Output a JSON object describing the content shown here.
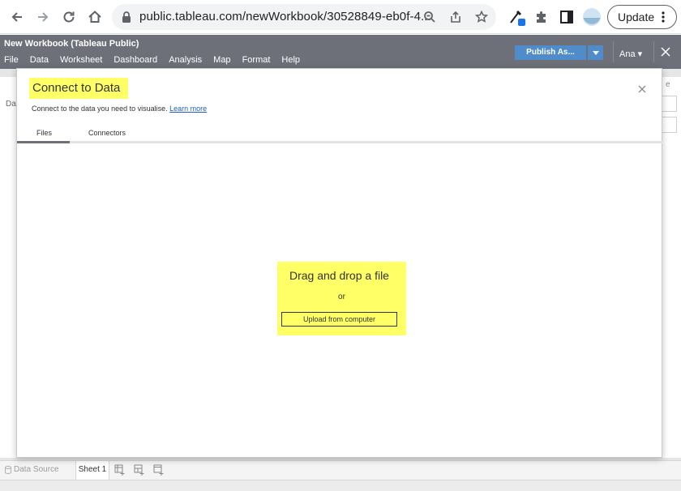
{
  "browser": {
    "url": "public.tableau.com/newWorkbook/30528849-eb0f-4...",
    "update_label": "Update",
    "icons": [
      "back-arrow-icon",
      "forward-arrow-icon",
      "reload-icon",
      "home-icon",
      "lock-icon",
      "zoom-icon",
      "share-icon",
      "star-icon",
      "eyedropper-extension-icon",
      "puzzle-icon",
      "sidepanel-icon",
      "profile-avatar-icon",
      "kebab-menu-icon"
    ]
  },
  "app": {
    "title": "New Workbook (Tableau Public)",
    "menu": [
      "File",
      "Data",
      "Worksheet",
      "Dashboard",
      "Analysis",
      "Map",
      "Format",
      "Help"
    ],
    "publish_label": "Publish As...",
    "user_label": "Ana ▾",
    "accent_color": "#4f8cc9",
    "header_color": "#6e7079"
  },
  "background": {
    "left_label": "Da",
    "right_label": "e"
  },
  "bottom_tabs": {
    "data_source": "Data Source",
    "sheet": "Sheet 1"
  },
  "modal": {
    "title": "Connect to Data",
    "subtitle": "Connect to the data you need to visualise.",
    "learn_more": "Learn more",
    "tabs": [
      "Files",
      "Connectors"
    ],
    "active_tab": "Files",
    "drop_title": "Drag and drop a file",
    "drop_or": "or",
    "upload_label": "Upload from computer",
    "highlight_color": "#ffff66"
  }
}
